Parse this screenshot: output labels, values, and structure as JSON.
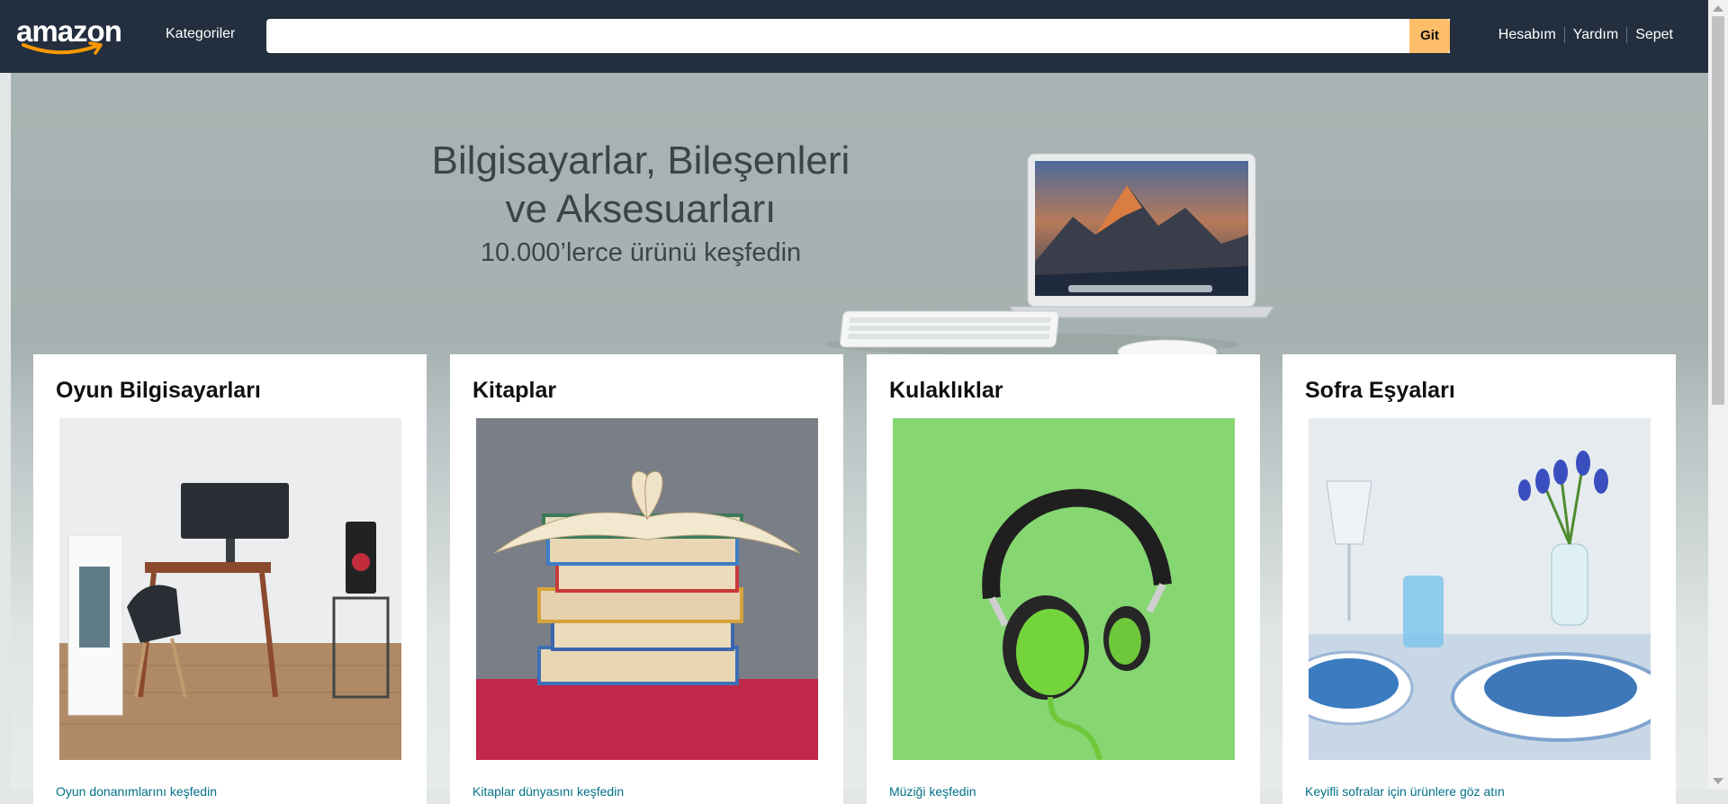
{
  "nav": {
    "logo_text": "amazon",
    "categories_label": "Kategoriler",
    "search_placeholder": "",
    "search_button": "Git",
    "links": [
      "Hesabım",
      "Yardım",
      "Sepet"
    ]
  },
  "hero": {
    "line1": "Bilgisayarlar, Bileşenleri",
    "line2": "ve Aksesuarları",
    "subline": "10.000’lerce ürünü keşfedin"
  },
  "cards": [
    {
      "title": "Oyun Bilgisayarları",
      "link": "Oyun donanımlarını keşfedin",
      "icon": "gaming-desk-image"
    },
    {
      "title": "Kitaplar",
      "link": "Kitaplar dünyasını keşfedin",
      "icon": "books-stack-image"
    },
    {
      "title": "Kulaklıklar",
      "link": "Müziği keşfedin",
      "icon": "headphones-image"
    },
    {
      "title": "Sofra Eşyaları",
      "link": "Keyifli sofralar için ürünlere göz atın",
      "icon": "table-setting-image"
    }
  ],
  "colors": {
    "nav_bg": "#232f3e",
    "search_button": "#febd69",
    "link": "#007185"
  }
}
